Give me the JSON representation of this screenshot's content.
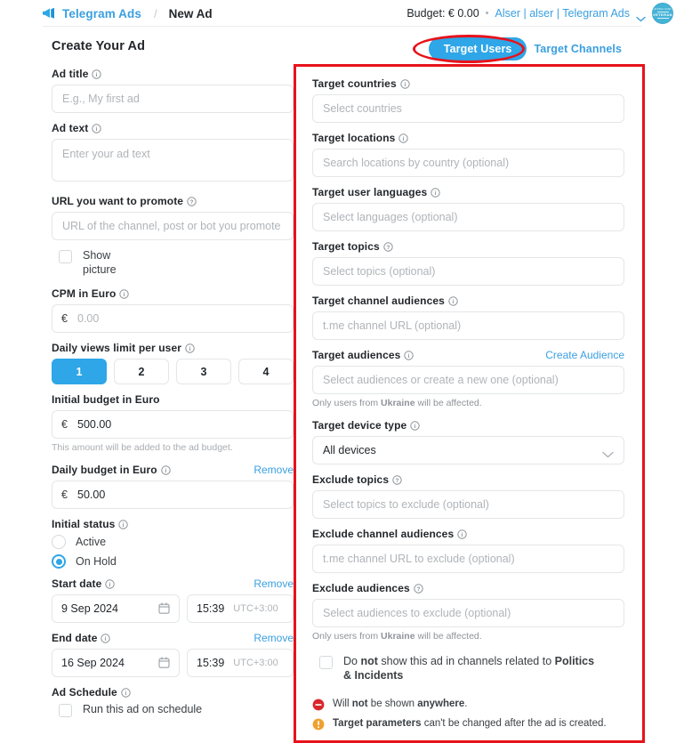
{
  "header": {
    "brand": "Telegram Ads",
    "brand_icon": "megaphone-icon",
    "separator": "/",
    "current_page": "New Ad",
    "budget_label": "Budget: € 0.00",
    "dot": "•",
    "account": "Alser | alser | Telegram Ads",
    "chevron_icon": "chevron-down-icon",
    "avatar_top_text": "NATIONAL GUARD",
    "avatar_main_text": "VETERAN",
    "accent_blue": "#3a9fe0"
  },
  "left": {
    "title": "Create Your Ad",
    "ad_title": {
      "label": "Ad title",
      "placeholder": "E.g., My first ad",
      "value": ""
    },
    "ad_text": {
      "label": "Ad text",
      "placeholder": "Enter your ad text",
      "value": ""
    },
    "url": {
      "label": "URL you want to promote",
      "placeholder": "URL of the channel, post or bot you promote",
      "value": ""
    },
    "show_picture": {
      "label_line1": "Show",
      "label_line2": "picture",
      "checked": false
    },
    "cpm": {
      "label": "CPM in Euro",
      "currency": "€",
      "placeholder": "0.00",
      "value": ""
    },
    "daily_views": {
      "label": "Daily views limit per user",
      "options": [
        "1",
        "2",
        "3",
        "4"
      ],
      "selected": "1"
    },
    "initial_budget": {
      "label": "Initial budget in Euro",
      "currency": "€",
      "value": "500.00",
      "hint": "This amount will be added to the ad budget."
    },
    "daily_budget": {
      "label": "Daily budget in Euro",
      "action": "Remove",
      "currency": "€",
      "value": "50.00"
    },
    "initial_status": {
      "label": "Initial status",
      "options": [
        {
          "label": "Active",
          "selected": false
        },
        {
          "label": "On Hold",
          "selected": true
        }
      ]
    },
    "start_date": {
      "label": "Start date",
      "action": "Remove",
      "date": "9 Sep 2024",
      "time": "15:39",
      "timezone": "UTC+3:00"
    },
    "end_date": {
      "label": "End date",
      "action": "Remove",
      "date": "16 Sep 2024",
      "time": "15:39",
      "timezone": "UTC+3:00"
    },
    "ad_schedule": {
      "label": "Ad Schedule",
      "checkbox_label": "Run this ad on schedule",
      "checked": false
    }
  },
  "right": {
    "tabs": [
      {
        "label": "Target Users",
        "active": true
      },
      {
        "label": "Target Channels",
        "active": false
      }
    ],
    "target_countries": {
      "label": "Target countries",
      "placeholder": "Select countries",
      "value": ""
    },
    "target_locations": {
      "label": "Target locations",
      "placeholder": "Search locations by country (optional)",
      "value": ""
    },
    "target_languages": {
      "label": "Target user languages",
      "placeholder": "Select languages (optional)",
      "value": ""
    },
    "target_topics": {
      "label": "Target topics",
      "placeholder": "Select topics (optional)",
      "value": ""
    },
    "target_channel_audiences": {
      "label": "Target channel audiences",
      "placeholder": "t.me channel URL (optional)",
      "value": ""
    },
    "target_audiences": {
      "label": "Target audiences",
      "action": "Create Audience",
      "placeholder": "Select audiences or create a new one (optional)",
      "value": "",
      "note_pre": "Only users from ",
      "note_bold": "Ukraine",
      "note_post": " will be affected."
    },
    "target_device_type": {
      "label": "Target device type",
      "value": "All devices"
    },
    "exclude_topics": {
      "label": "Exclude topics",
      "placeholder": "Select topics to exclude (optional)",
      "value": ""
    },
    "exclude_channel_audiences": {
      "label": "Exclude channel audiences",
      "placeholder": "t.me channel URL to exclude (optional)",
      "value": ""
    },
    "exclude_audiences": {
      "label": "Exclude audiences",
      "placeholder": "Select audiences to exclude (optional)",
      "value": "",
      "note_pre": "Only users from ",
      "note_bold": "Ukraine",
      "note_post": " will be affected."
    },
    "politics_checkbox": {
      "part1": "Do ",
      "bold1": "not",
      "part2": " show this ad in channels related to ",
      "bold2": "Politics & Incidents",
      "checked": false
    },
    "notices": [
      {
        "icon": "minus-circle-icon",
        "color": "#d9262c",
        "pre": "Will ",
        "bold": "not",
        "post": " be shown ",
        "bold2": "anywhere",
        "post2": "."
      },
      {
        "icon": "warning-circle-icon",
        "color": "#f0a030",
        "bold": "Target parameters",
        "post": " can't be changed after the ad is created."
      }
    ]
  },
  "annotations": {
    "highlight_color": "#e8121a",
    "ellipse_target": "Target Users",
    "box_target": "target-users-panel"
  }
}
